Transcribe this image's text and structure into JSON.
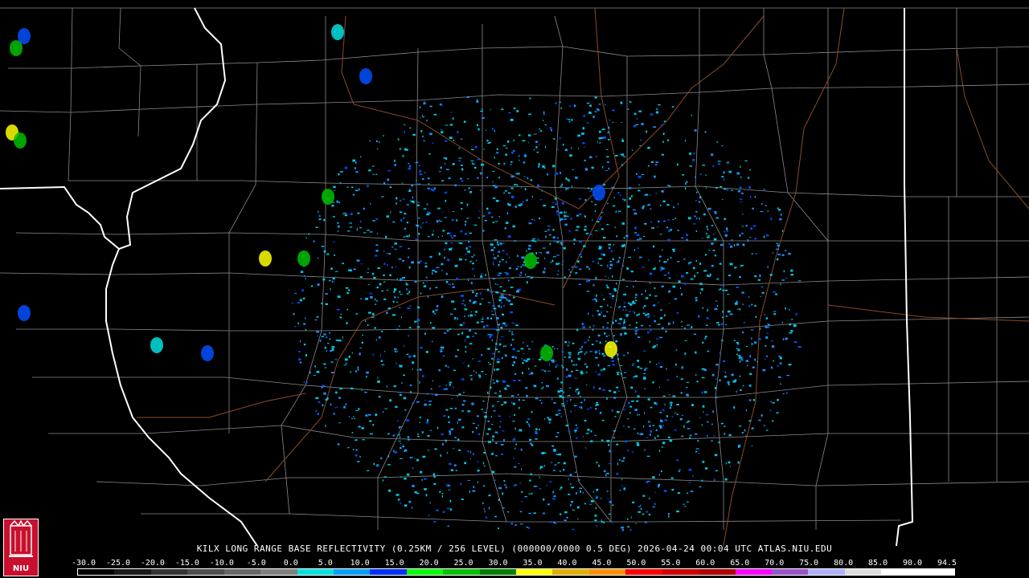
{
  "map": {
    "site": "KILX",
    "product": "LONG RANGE BASE REFLECTIVITY",
    "resolution": "(0.25KM / 256 LEVEL)",
    "volume": "(000000/0000 0.5 DEG)",
    "timestamp": "2026-04-24 00:04 UTC",
    "source": "ATLAS.NIU.EDU"
  },
  "caption": "KILX LONG RANGE BASE REFLECTIVITY (0.25KM / 256 LEVEL) (000000/0000 0.5 DEG) 2026-04-24 00:04 UTC  ATLAS.NIU.EDU",
  "scale": {
    "labels": [
      "-30.0",
      "-25.0",
      "-20.0",
      "-15.0",
      "-10.0",
      "-5.0",
      "0.0",
      "5.0",
      "10.0",
      "15.0",
      "20.0",
      "25.0",
      "30.0",
      "35.0",
      "40.0",
      "45.0",
      "50.0",
      "55.0",
      "60.0",
      "65.0",
      "70.0",
      "75.0",
      "80.0",
      "85.0",
      "90.0",
      "94.5"
    ],
    "colors": [
      "#000000",
      "#1a1a1a",
      "#333333",
      "#4d4d4d",
      "#666666",
      "#808080",
      "#00e0e0",
      "#00a0ff",
      "#0030ff",
      "#00ff00",
      "#00c000",
      "#008000",
      "#ffff00",
      "#e0b000",
      "#ff9000",
      "#ff0000",
      "#d00000",
      "#b00000",
      "#ff00ff",
      "#9955cc",
      "#b0b0ff",
      "#dddddd",
      "#ffffff",
      "#ffffff"
    ]
  },
  "logo": {
    "text": "NIU"
  },
  "colors": {
    "state_border": "#ffffff",
    "county_border": "#8a8a8a",
    "river": "#8b4a2a",
    "background": "#000000"
  }
}
